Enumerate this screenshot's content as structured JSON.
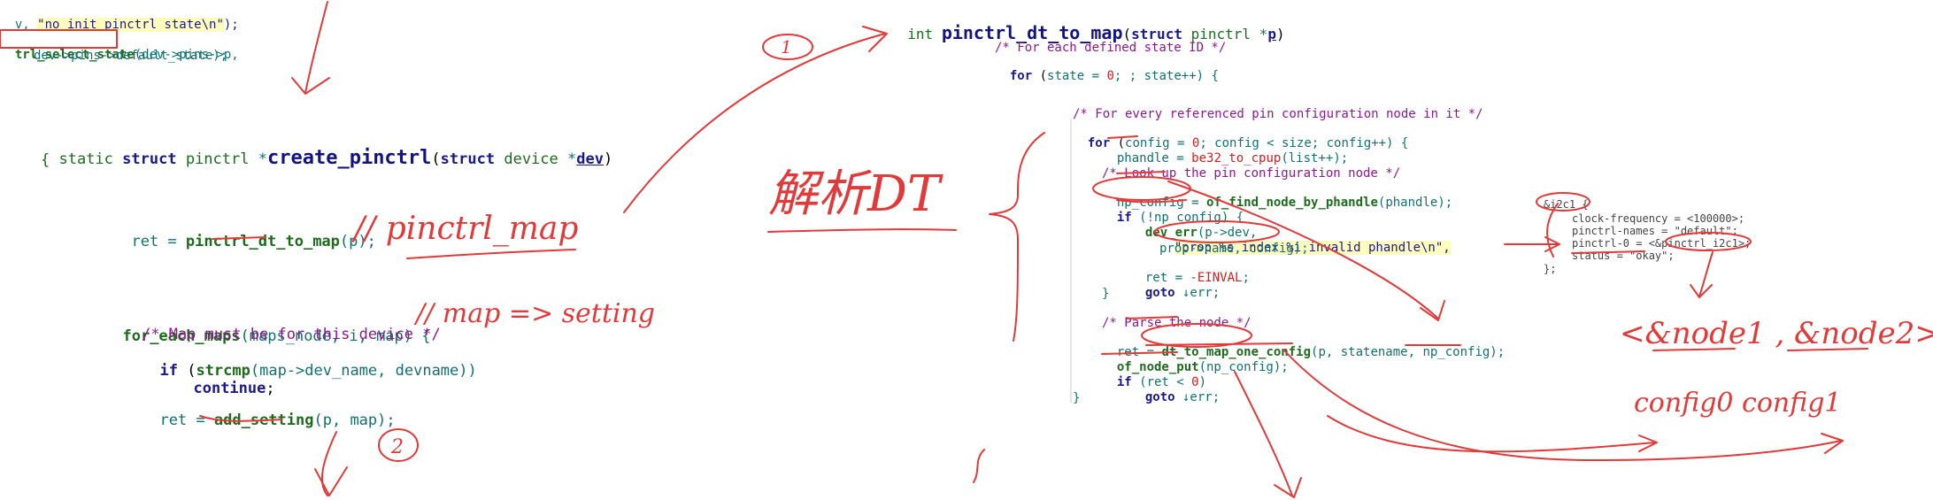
{
  "left_top": {
    "line1_prefix": "v, ",
    "line1_string": "\"no init pinctrl state\\n\"",
    "line1_suffix": ");",
    "call_name": "trl_select_state",
    "call_args": "(dev->pins->p,",
    "call_args2": "dev->pins->default_state);"
  },
  "create_pinctrl": {
    "static": "static",
    "struct": "struct",
    "type": "pinctrl",
    "star": "*",
    "name": "create_pinctrl",
    "params_pre": "(",
    "param_struct": "struct",
    "param_type": "device",
    "param_star": "*",
    "param_name": "dev",
    "params_post": ")",
    "brace": "{",
    "ret_line_var": "ret = ",
    "ret_line_fn": "pinctrl_dt_to_map",
    "ret_line_args": "(p);",
    "foreach_fn": "for_each_maps",
    "foreach_args": "(maps_node, i, map) {",
    "comment": "/* Map must be for this device */",
    "if_kw": "if",
    "if_fn": "strcmp",
    "if_args": "(map->dev_name, devname))",
    "continue_kw": "continue",
    "continue_semi": ";",
    "ret2_var": "ret = ",
    "ret2_fn": "add_setting",
    "ret2_args": "(p, map);"
  },
  "dt_to_map": {
    "ret_type": "int",
    "name": "pinctrl_dt_to_map",
    "paren": "(",
    "param_struct": "struct",
    "param_type": "pinctrl",
    "param_star": "*",
    "param_name": "p",
    "paren_close": ")",
    "comment1": "/* For each defined state ID */",
    "for1_kw": "for",
    "for1_a": " (",
    "for1_var": "state",
    "for1_b": " = ",
    "for1_zero": "0",
    "for1_c": "; ; state++) {",
    "comment2": "/* For every referenced pin configuration node in it */",
    "for2_kw": "for",
    "for2_a": " (",
    "for2_var": "config",
    "for2_b": " = ",
    "for2_zero": "0",
    "for2_c": "; config < size; config++) {",
    "phandle_a": "phandle = ",
    "phandle_fn": "be32_to_cpup",
    "phandle_b": "(list++);",
    "comment3": "/* Look up the pin configuration node */",
    "npcfg_a": "np_config = ",
    "npcfg_fn": "of_find_node_by_phandle",
    "npcfg_b": "(phandle);",
    "if1_kw": "if",
    "if1_b": " (!np_config) {",
    "deverr_fn": "dev_err",
    "deverr_b": "(p->dev,",
    "deverr_str": "\"prop %s index %i invalid phandle\\n\",",
    "deverr_c": "prop->name, config);",
    "ret_einval_a": "ret = -",
    "ret_einval_b": "EINVAL",
    "ret_einval_c": ";",
    "goto1_kw": "goto",
    "goto1_b": " ↓err;",
    "close1": "}",
    "comment4": "/* Parse the node */",
    "ret_parse_a": "ret = ",
    "ret_parse_fn": "dt_to_map_one_config",
    "ret_parse_b": "(p, statename, np_config);",
    "nodeput_fn": "of_node_put",
    "nodeput_b": "(np_config);",
    "if2_kw": "if",
    "if2_b": " (ret < ",
    "if2_zero": "0",
    "if2_c": ")",
    "goto2_kw": "goto",
    "goto2_b": " ↓err;",
    "close2": "}"
  },
  "dt_snippet": {
    "l1": "&i2c1 {",
    "l2": "clock-frequency = <100000>;",
    "l3": "pinctrl-names = \"default\";",
    "l4": "pinctrl-0 = <&pinctrl_i2c1>;",
    "l5": "status = \"okay\";",
    "l6": "};"
  },
  "handwriting": {
    "pinctrl_map": "// pinctrl_map",
    "map_setting": "// map => setting",
    "circle_one": "1",
    "circle_two": "2",
    "chinese": "解析DT",
    "nodes": "<&node1 , &node2>",
    "configs": "config0    config1"
  }
}
